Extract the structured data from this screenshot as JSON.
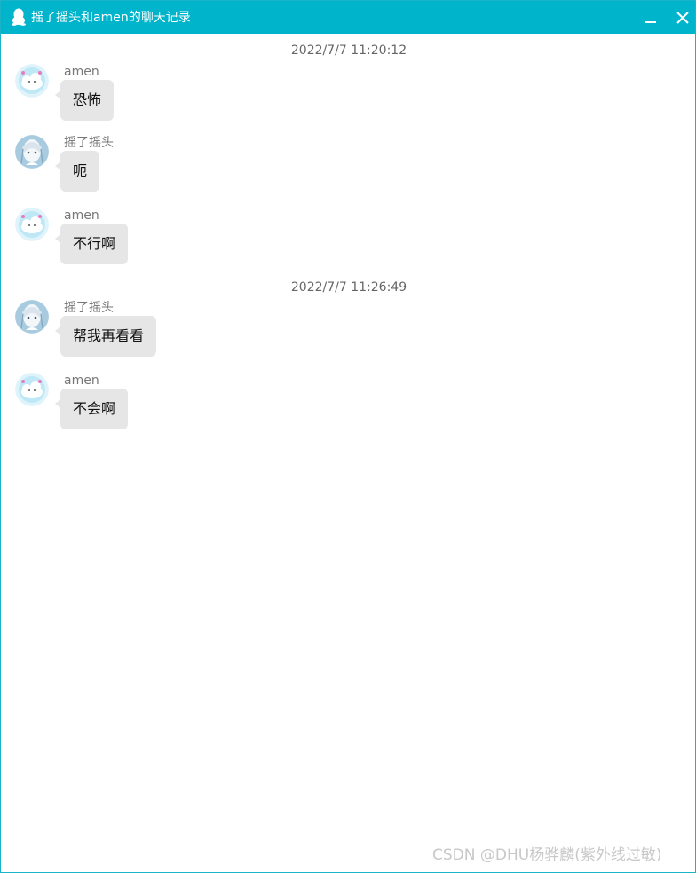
{
  "window": {
    "title": "摇了摇头和amen的聊天记录",
    "app_icon": "qq-penguin-icon",
    "minimize_icon": "minimize-icon",
    "close_icon": "close-icon",
    "accent_color": "#00b4cc"
  },
  "chat": {
    "timestamps": [
      "2022/7/7 11:20:12",
      "2022/7/7 11:26:49"
    ],
    "messages": [
      {
        "sender": "amen",
        "text": "恐怖",
        "avatar": "cloud-avatar"
      },
      {
        "sender": "摇了摇头",
        "text": "呃",
        "avatar": "anime-avatar"
      },
      {
        "sender": "amen",
        "text": "不行啊",
        "avatar": "cloud-avatar"
      },
      {
        "sender": "摇了摇头",
        "text": "帮我再看看",
        "avatar": "anime-avatar"
      },
      {
        "sender": "amen",
        "text": "不会啊",
        "avatar": "cloud-avatar"
      }
    ],
    "bubble_color": "#e6e6e6"
  },
  "watermark": "CSDN @DHU杨骅麟(紫外线过敏)"
}
